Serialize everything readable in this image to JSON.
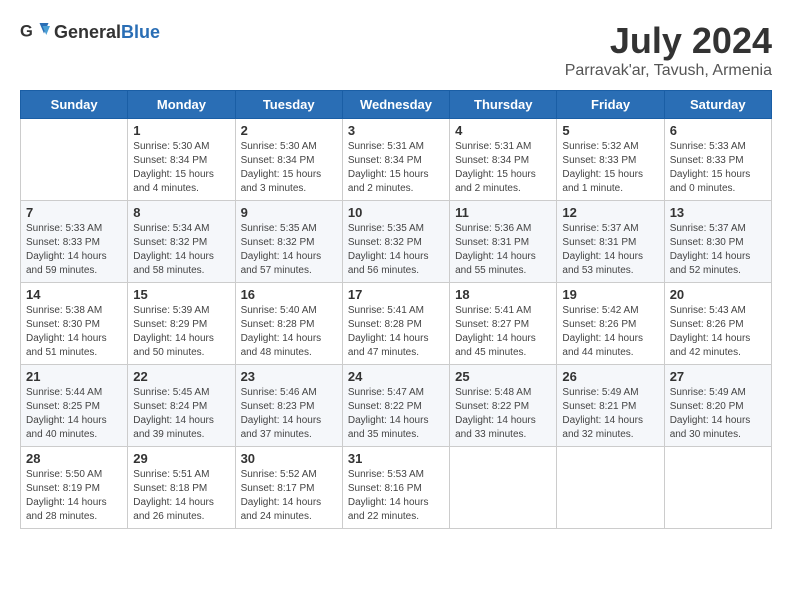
{
  "header": {
    "logo_general": "General",
    "logo_blue": "Blue",
    "month_year": "July 2024",
    "location": "Parravak'ar, Tavush, Armenia"
  },
  "days_of_week": [
    "Sunday",
    "Monday",
    "Tuesday",
    "Wednesday",
    "Thursday",
    "Friday",
    "Saturday"
  ],
  "weeks": [
    [
      {
        "day": "",
        "info": ""
      },
      {
        "day": "1",
        "info": "Sunrise: 5:30 AM\nSunset: 8:34 PM\nDaylight: 15 hours\nand 4 minutes."
      },
      {
        "day": "2",
        "info": "Sunrise: 5:30 AM\nSunset: 8:34 PM\nDaylight: 15 hours\nand 3 minutes."
      },
      {
        "day": "3",
        "info": "Sunrise: 5:31 AM\nSunset: 8:34 PM\nDaylight: 15 hours\nand 2 minutes."
      },
      {
        "day": "4",
        "info": "Sunrise: 5:31 AM\nSunset: 8:34 PM\nDaylight: 15 hours\nand 2 minutes."
      },
      {
        "day": "5",
        "info": "Sunrise: 5:32 AM\nSunset: 8:33 PM\nDaylight: 15 hours\nand 1 minute."
      },
      {
        "day": "6",
        "info": "Sunrise: 5:33 AM\nSunset: 8:33 PM\nDaylight: 15 hours\nand 0 minutes."
      }
    ],
    [
      {
        "day": "7",
        "info": "Sunrise: 5:33 AM\nSunset: 8:33 PM\nDaylight: 14 hours\nand 59 minutes."
      },
      {
        "day": "8",
        "info": "Sunrise: 5:34 AM\nSunset: 8:32 PM\nDaylight: 14 hours\nand 58 minutes."
      },
      {
        "day": "9",
        "info": "Sunrise: 5:35 AM\nSunset: 8:32 PM\nDaylight: 14 hours\nand 57 minutes."
      },
      {
        "day": "10",
        "info": "Sunrise: 5:35 AM\nSunset: 8:32 PM\nDaylight: 14 hours\nand 56 minutes."
      },
      {
        "day": "11",
        "info": "Sunrise: 5:36 AM\nSunset: 8:31 PM\nDaylight: 14 hours\nand 55 minutes."
      },
      {
        "day": "12",
        "info": "Sunrise: 5:37 AM\nSunset: 8:31 PM\nDaylight: 14 hours\nand 53 minutes."
      },
      {
        "day": "13",
        "info": "Sunrise: 5:37 AM\nSunset: 8:30 PM\nDaylight: 14 hours\nand 52 minutes."
      }
    ],
    [
      {
        "day": "14",
        "info": "Sunrise: 5:38 AM\nSunset: 8:30 PM\nDaylight: 14 hours\nand 51 minutes."
      },
      {
        "day": "15",
        "info": "Sunrise: 5:39 AM\nSunset: 8:29 PM\nDaylight: 14 hours\nand 50 minutes."
      },
      {
        "day": "16",
        "info": "Sunrise: 5:40 AM\nSunset: 8:28 PM\nDaylight: 14 hours\nand 48 minutes."
      },
      {
        "day": "17",
        "info": "Sunrise: 5:41 AM\nSunset: 8:28 PM\nDaylight: 14 hours\nand 47 minutes."
      },
      {
        "day": "18",
        "info": "Sunrise: 5:41 AM\nSunset: 8:27 PM\nDaylight: 14 hours\nand 45 minutes."
      },
      {
        "day": "19",
        "info": "Sunrise: 5:42 AM\nSunset: 8:26 PM\nDaylight: 14 hours\nand 44 minutes."
      },
      {
        "day": "20",
        "info": "Sunrise: 5:43 AM\nSunset: 8:26 PM\nDaylight: 14 hours\nand 42 minutes."
      }
    ],
    [
      {
        "day": "21",
        "info": "Sunrise: 5:44 AM\nSunset: 8:25 PM\nDaylight: 14 hours\nand 40 minutes."
      },
      {
        "day": "22",
        "info": "Sunrise: 5:45 AM\nSunset: 8:24 PM\nDaylight: 14 hours\nand 39 minutes."
      },
      {
        "day": "23",
        "info": "Sunrise: 5:46 AM\nSunset: 8:23 PM\nDaylight: 14 hours\nand 37 minutes."
      },
      {
        "day": "24",
        "info": "Sunrise: 5:47 AM\nSunset: 8:22 PM\nDaylight: 14 hours\nand 35 minutes."
      },
      {
        "day": "25",
        "info": "Sunrise: 5:48 AM\nSunset: 8:22 PM\nDaylight: 14 hours\nand 33 minutes."
      },
      {
        "day": "26",
        "info": "Sunrise: 5:49 AM\nSunset: 8:21 PM\nDaylight: 14 hours\nand 32 minutes."
      },
      {
        "day": "27",
        "info": "Sunrise: 5:49 AM\nSunset: 8:20 PM\nDaylight: 14 hours\nand 30 minutes."
      }
    ],
    [
      {
        "day": "28",
        "info": "Sunrise: 5:50 AM\nSunset: 8:19 PM\nDaylight: 14 hours\nand 28 minutes."
      },
      {
        "day": "29",
        "info": "Sunrise: 5:51 AM\nSunset: 8:18 PM\nDaylight: 14 hours\nand 26 minutes."
      },
      {
        "day": "30",
        "info": "Sunrise: 5:52 AM\nSunset: 8:17 PM\nDaylight: 14 hours\nand 24 minutes."
      },
      {
        "day": "31",
        "info": "Sunrise: 5:53 AM\nSunset: 8:16 PM\nDaylight: 14 hours\nand 22 minutes."
      },
      {
        "day": "",
        "info": ""
      },
      {
        "day": "",
        "info": ""
      },
      {
        "day": "",
        "info": ""
      }
    ]
  ]
}
